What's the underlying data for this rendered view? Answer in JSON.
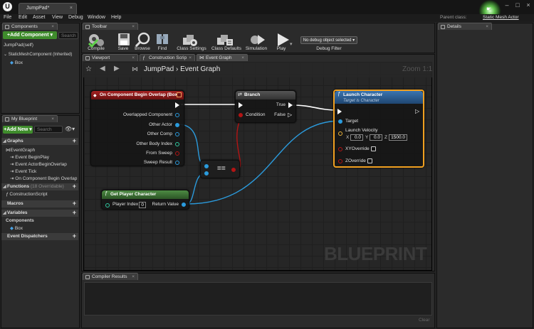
{
  "window": {
    "logo": "U",
    "doc_tab": "JumpPad*",
    "parent_class_label": "Parent class:",
    "parent_class_value": "Static Mesh Actor",
    "minimize": "–",
    "maximize": "□",
    "close": "×"
  },
  "menu": [
    "File",
    "Edit",
    "Asset",
    "View",
    "Debug",
    "Window",
    "Help"
  ],
  "components_panel": {
    "tab": "Components",
    "add_button": "+Add Component ▾",
    "search_placeholder": "Search",
    "items": [
      "JumpPad(self)",
      "StaticMeshComponent (Inherited)",
      "Box"
    ]
  },
  "my_blueprint_panel": {
    "tab": "My Blueprint",
    "add_button": "+Add New ▾",
    "search_placeholder": "Search",
    "categories": {
      "graphs": "Graphs",
      "functions": "Functions",
      "functions_sub": "(18 Overridable)",
      "macros": "Macros",
      "variables": "Variables",
      "components": "Components",
      "event_dispatchers": "Event Dispatchers"
    },
    "graph_items": [
      "EventGraph",
      "Event BeginPlay",
      "Event ActorBeginOverlap",
      "Event Tick",
      "On Component Begin Overlap"
    ],
    "function_items": [
      "ConstructionScript"
    ],
    "component_items": [
      "Box"
    ]
  },
  "toolbar": {
    "tab": "Toolbar",
    "buttons": {
      "compile": "Compile",
      "save": "Save",
      "browse": "Browse",
      "find": "Find",
      "class_settings": "Class Settings",
      "class_defaults": "Class Defaults",
      "simulation": "Simulation",
      "play": "Play"
    },
    "debug_select": "No debug object selected ▾",
    "debug_filter": "Debug Filter"
  },
  "editor_tabs": [
    "Viewport",
    "Construction Scrip",
    "Event Graph"
  ],
  "details_panel": {
    "tab": "Details"
  },
  "graph": {
    "breadcrumb_root": "JumpPad",
    "breadcrumb_sep": "›",
    "breadcrumb_leaf": "Event Graph",
    "zoom": "Zoom 1:1",
    "watermark": "BLUEPRINT",
    "nodes": {
      "event": {
        "title": "On Component Begin Overlap (Box)",
        "pins": [
          "Overlapped Component",
          "Other Actor",
          "Other Comp",
          "Other Body Index",
          "From Sweep",
          "Sweep Result"
        ]
      },
      "branch": {
        "title": "Branch",
        "condition": "Condition",
        "true": "True",
        "false": "False"
      },
      "equals": {
        "title": "=="
      },
      "get_player": {
        "title": "Get Player Character",
        "player_index": "Player Index",
        "player_index_value": "0",
        "return_value": "Return Value"
      },
      "launch": {
        "title": "Launch Character",
        "subtitle": "Target is Character",
        "target": "Target",
        "launch_velocity": "Launch Velocity",
        "vx_label": "X",
        "vx": "0.0",
        "vy_label": "Y",
        "vy": "0.0",
        "vz_label": "Z",
        "vz": "1500.0",
        "xy_override": "XYOverride",
        "z_override": "ZOverride"
      }
    }
  },
  "compiler_results": {
    "tab": "Compiler Results",
    "clear": "Clear"
  },
  "colors": {
    "event_header": "#8b1818",
    "function_header_blue": "#2b5d92",
    "pure_header_green": "#3c6b34",
    "object_pin": "#2b9bdd",
    "bool_pin": "#b31414",
    "struct_pin": "#e9b23a",
    "selection_outline": "#f0a020"
  }
}
